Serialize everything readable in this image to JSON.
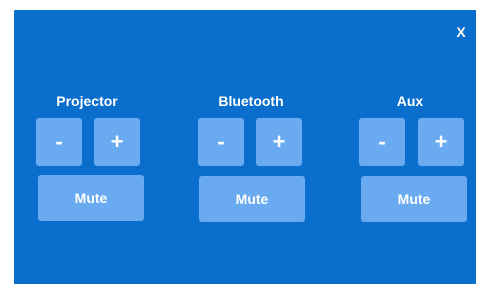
{
  "close_label": "X",
  "groups": [
    {
      "title": "Projector",
      "minus_label": "-",
      "plus_label": "+",
      "mute_label": "Mute"
    },
    {
      "title": "Bluetooth",
      "minus_label": "-",
      "plus_label": "+",
      "mute_label": "Mute"
    },
    {
      "title": "Aux",
      "minus_label": "-",
      "plus_label": "+",
      "mute_label": "Mute"
    }
  ],
  "colors": {
    "panel_background": "#0a6ecd",
    "button_background": "#6aaaf0",
    "text": "#ffffff"
  }
}
